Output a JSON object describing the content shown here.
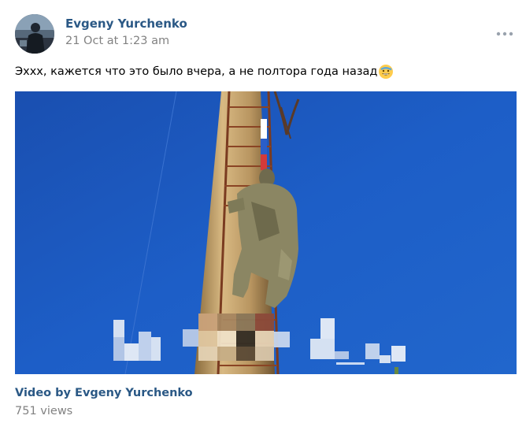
{
  "post": {
    "author_name": "Evgeny Yurchenko",
    "date": "21 Oct at 1:23 am",
    "text": "Эххх, кажется что это было вчера, а не полтора года назад",
    "emoji_icon": "cold-sweat-smile-emoji",
    "more_icon": "more-dots-icon"
  },
  "video": {
    "title": "Video by Evgeny Yurchenko",
    "views": "751 views"
  },
  "colors": {
    "link": "#2a5885",
    "secondary_text": "#828282",
    "sky": "#1b56b8"
  }
}
